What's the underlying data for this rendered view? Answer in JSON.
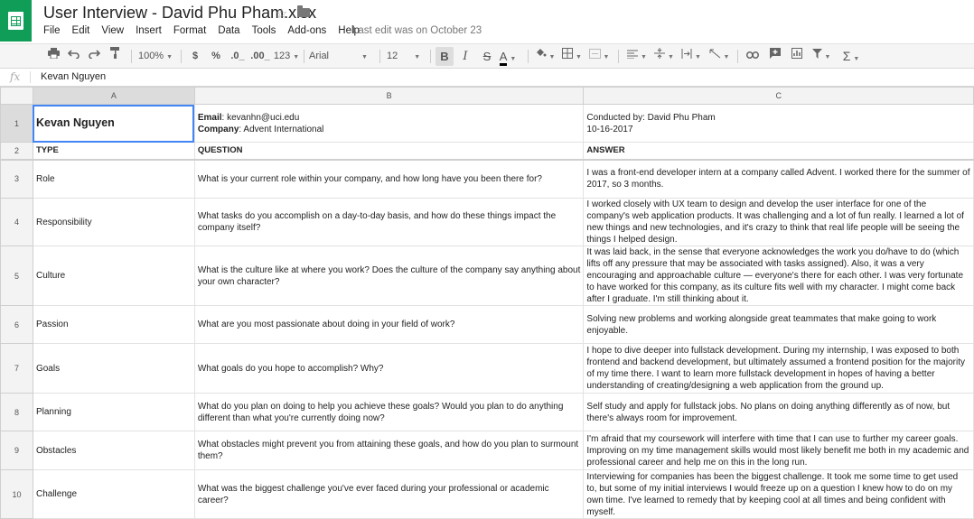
{
  "app": {
    "doc_title": "User Interview - David Phu Pham.xlsx",
    "menus": [
      "File",
      "Edit",
      "View",
      "Insert",
      "Format",
      "Data",
      "Tools",
      "Add-ons",
      "Help"
    ],
    "last_edit": "Last edit was on October 23"
  },
  "toolbar": {
    "zoom": "100%",
    "currency": "$",
    "percent": "%",
    "dec_decrease": ".0_",
    "dec_increase": ".00_",
    "more_formats": "123",
    "font": "Arial",
    "font_size": "12",
    "bold": "B",
    "italic": "I",
    "strike": "S",
    "text_color": "A",
    "sum": "Σ"
  },
  "formula_bar": {
    "fx": "fx",
    "value": "Kevan Nguyen"
  },
  "columns": [
    "A",
    "B",
    "C"
  ],
  "rows": [
    {
      "num": "1",
      "a": "Kevan Nguyen",
      "b_email_label": "Email",
      "b_email": ": kevanhn@uci.edu",
      "b_company_label": "Company",
      "b_company": ": Advent International",
      "c_line1": "Conducted by: David Phu Pham",
      "c_line2": "10-16-2017"
    },
    {
      "num": "2",
      "a": "TYPE",
      "b": "QUESTION",
      "c": "ANSWER"
    },
    {
      "num": "3",
      "a": "Role",
      "b": "What is your current role within your company, and how long have you been there for?",
      "c": "I was a front-end developer intern at a company called Advent. I worked there for the summer of 2017, so 3 months."
    },
    {
      "num": "4",
      "a": "Responsibility",
      "b": "What tasks do you accomplish on a day-to-day basis, and how do these things impact the company itself?",
      "c": "I worked closely with UX team to design and develop the user interface for one of the company's web application products. It was challenging and a lot of fun really. I learned a lot of new things and new technologies, and it's crazy to think that real life people will be seeing the things I helped design."
    },
    {
      "num": "5",
      "a": "Culture",
      "b": "What is the culture like at where you work? Does the culture of the company say anything about your own character?",
      "c": "It was laid back, in the sense that everyone acknowledges the work you do/have to do (which lifts off any pressure that may be associated with tasks assigned). Also, it was a very encouraging and approachable culture — everyone's there for each other. I was very fortunate to have worked for this company, as its culture fits well with my character. I might come back after I graduate. I'm still thinking about it."
    },
    {
      "num": "6",
      "a": "Passion",
      "b": "What are you most passionate about doing in your field of work?",
      "c": "Solving new problems and working alongside great teammates that make going to work enjoyable."
    },
    {
      "num": "7",
      "a": "Goals",
      "b": "What goals do you hope to accomplish? Why?",
      "c": "I hope to dive deeper into fullstack development. During my internship, I was exposed to both frontend and backend development, but ultimately assumed a frontend position for the majority of my time there. I want to learn more fullstack development in hopes of having a better understanding of creating/designing a web application from the ground up."
    },
    {
      "num": "8",
      "a": "Planning",
      "b": "What do you plan on doing to help you achieve these goals? Would you plan to do anything different than what you're currently doing now?",
      "c": "Self study and apply for fullstack jobs. No plans on doing anything differently as of now, but there's always room for improvement."
    },
    {
      "num": "9",
      "a": "Obstacles",
      "b": "What obstacles might prevent you from attaining these goals, and how do you plan to surmount them?",
      "c": "I'm afraid that my coursework will interfere with time that I can use to further my career goals. Improving on my time management skills would most likely benefit me both in my academic and professional career and help me on this in the long run."
    },
    {
      "num": "10",
      "a": "Challenge",
      "b": "What was the biggest challenge you've ever faced during your professional or academic career?",
      "c": "Interviewing for companies has been the biggest challenge. It took me some time to get used to, but some of my initial interviews I would freeze up on a question I knew how to do on my own time. I've learned to remedy that by keeping cool at all times and being confident with myself."
    }
  ]
}
